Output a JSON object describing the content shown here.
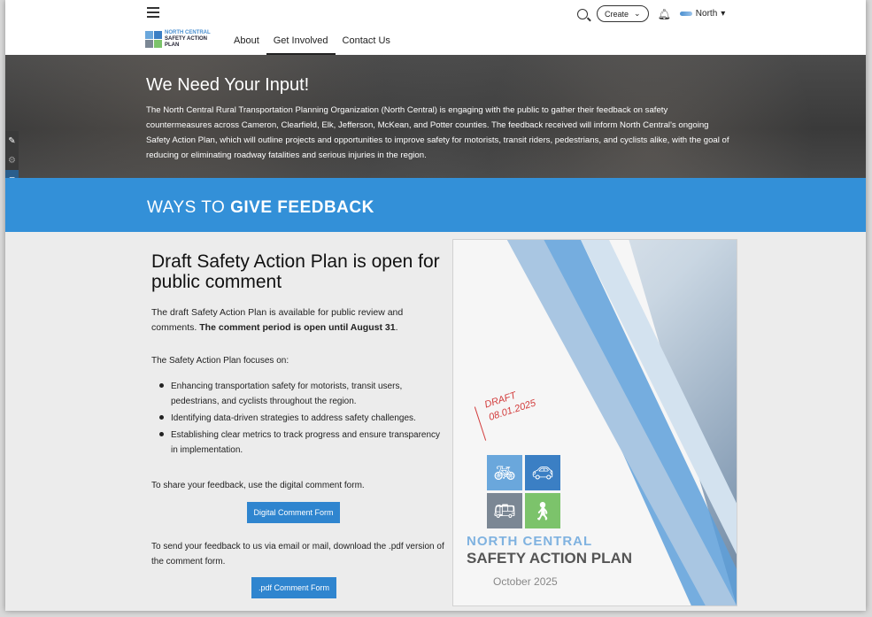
{
  "header": {
    "logo_line1": "NORTH CENTRAL",
    "logo_line2": "SAFETY ACTION PLAN",
    "nav": [
      "About",
      "Get Involved",
      "Contact Us"
    ],
    "create_label": "Create",
    "region_label": "North"
  },
  "hero": {
    "title": "We Need Your Input!",
    "body": "The North Central Rural Transportation Planning Organization (North Central) is engaging with the public to gather their feedback on safety countermeasures across Cameron, Clearfield, Elk, Jefferson, McKean, and Potter counties. The feedback received will inform North Central's ongoing Safety Action Plan, which will outline projects and opportunities to improve safety for motorists, transit riders, pedestrians, and cyclists alike, with the goal of reducing or eliminating roadway fatalities and serious injuries in the region."
  },
  "band": {
    "prefix": "WAYS TO",
    "bold": "GIVE FEEDBACK"
  },
  "main": {
    "title": "Draft Safety Action Plan is open for public comment",
    "intro": "The draft Safety Action Plan is available for public review and comments. ",
    "intro_bold": "The comment period is open until August 31",
    "intro_end": ".",
    "focus_label": "The Safety Action Plan focuses on:",
    "bullets": [
      "Enhancing transportation safety for motorists, transit users, pedestrians, and cyclists throughout the region.",
      "Identifying data-driven strategies to address safety challenges.",
      "Establishing clear metrics to track progress and ensure transparency in implementation."
    ],
    "share_text": "To share your feedback, use the digital comment form.",
    "digital_button": "Digital Comment Form",
    "mail_text": "To send your feedback to us via email or mail, download the .pdf version of the comment form.",
    "pdf_button": ".pdf Comment Form"
  },
  "poster": {
    "draft": "DRAFT",
    "date": "08.01.2025",
    "line1": "NORTH CENTRAL",
    "line2": "SAFETY ACTION PLAN",
    "month": "October 2025"
  },
  "colors": {
    "accent": "#3390d8",
    "button": "#2f85cf",
    "draft": "#d23b3b"
  }
}
